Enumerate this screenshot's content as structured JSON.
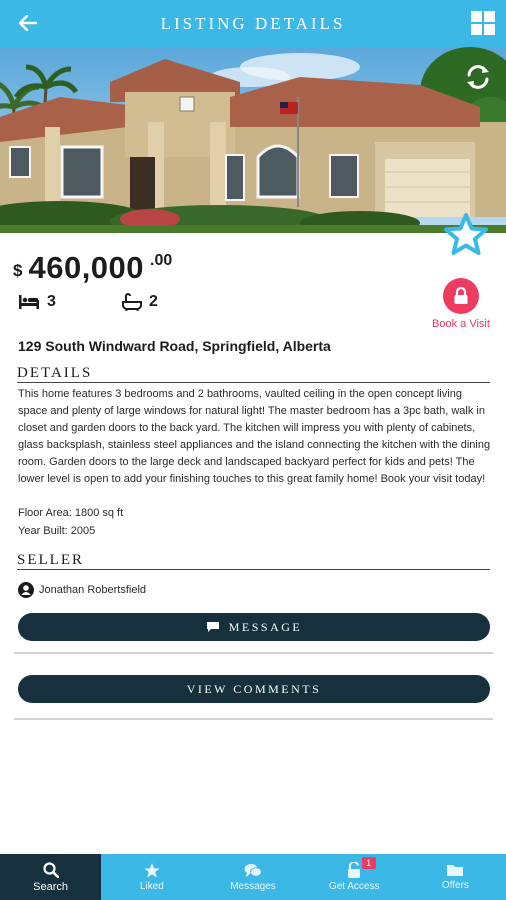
{
  "header": {
    "title": "Listing Details",
    "back_icon": "arrow-left-icon",
    "menu_icon": "grid-icon"
  },
  "listing": {
    "currency": "$",
    "price": "460,000",
    "cents": ".00",
    "bedrooms": "3",
    "bathrooms": "2",
    "address": "129 South Windward Road, Springfield, Alberta",
    "details_heading": "Details",
    "description": "This home features 3 bedrooms and 2 bathrooms, vaulted ceiling in the open concept living space and plenty of large windows for natural light! The master bedroom has a 3pc bath, walk in closet and garden doors to the back yard. The kitchen will impress you with plenty of cabinets, glass backsplash, stainless steel appliances and the island connecting the kitchen with the dining room. Garden doors to the large deck and landscaped backyard perfect for kids and pets! The lower level is open to add your finishing touches to this great family home! Book your visit today!",
    "floor_area": "Floor Area: 1800 sq ft",
    "year_built": "Year Built: 2005"
  },
  "book_visit": {
    "label": "Book a Visit",
    "color": "#ee3b62"
  },
  "seller": {
    "heading": "Seller",
    "name": "Jonathan  Robertsfield"
  },
  "actions": {
    "message_label": "Message",
    "comments_label": "View Comments"
  },
  "nav": {
    "tabs": [
      {
        "label": "Search",
        "icon": "search-icon",
        "active": true
      },
      {
        "label": "Liked",
        "icon": "star-icon"
      },
      {
        "label": "Messages",
        "icon": "chat-icon"
      },
      {
        "label": "Get Access",
        "icon": "lock-icon",
        "badge": "1"
      },
      {
        "label": "Offers",
        "icon": "folder-icon"
      }
    ]
  },
  "colors": {
    "accent": "#3bb8e5",
    "dark": "#16303e",
    "pink": "#ee3b62"
  }
}
